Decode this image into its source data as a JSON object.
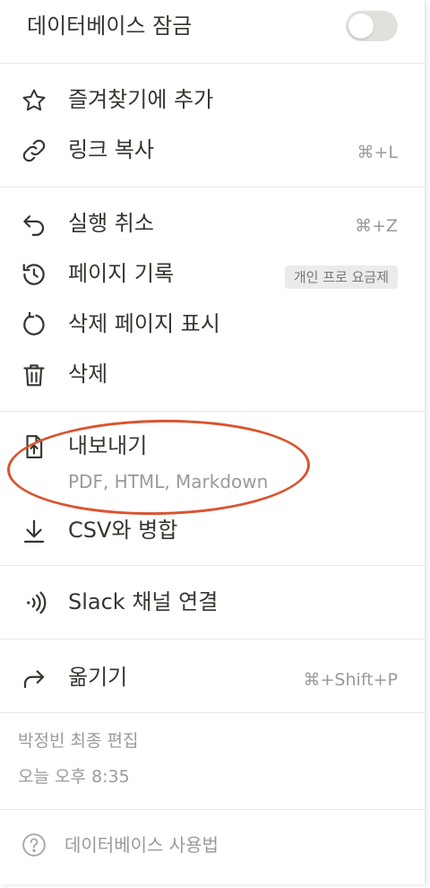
{
  "lock": {
    "label": "데이터베이스 잠금",
    "enabled": false
  },
  "menu": {
    "favorite": {
      "label": "즐겨찾기에 추가",
      "icon": "star-icon"
    },
    "copy_link": {
      "label": "링크 복사",
      "shortcut": "⌘+L",
      "icon": "link-icon"
    },
    "undo": {
      "label": "실행 취소",
      "shortcut": "⌘+Z",
      "icon": "undo-icon"
    },
    "history": {
      "label": "페이지 기록",
      "badge": "개인 프로 요금제",
      "icon": "history-icon"
    },
    "deleted_pages": {
      "label": "삭제 페이지 표시",
      "icon": "restore-icon"
    },
    "delete": {
      "label": "삭제",
      "icon": "trash-icon"
    },
    "export": {
      "label": "내보내기",
      "sub": "PDF, HTML, Markdown",
      "icon": "export-icon"
    },
    "merge_csv": {
      "label": "CSV와 병합",
      "icon": "download-icon"
    },
    "slack": {
      "label": "Slack 채널 연결",
      "icon": "broadcast-icon"
    },
    "move": {
      "label": "옮기기",
      "shortcut": "⌘+Shift+P",
      "icon": "move-arrow-icon"
    }
  },
  "meta": {
    "edited_by": "박정빈 최종 편집",
    "edited_time": "오늘 오후 8:35"
  },
  "help": {
    "label": "데이터베이스 사용법",
    "icon": "question-icon"
  },
  "colors": {
    "annotation": "#d9542f",
    "text": "#37352f",
    "muted": "#9b9a97"
  }
}
